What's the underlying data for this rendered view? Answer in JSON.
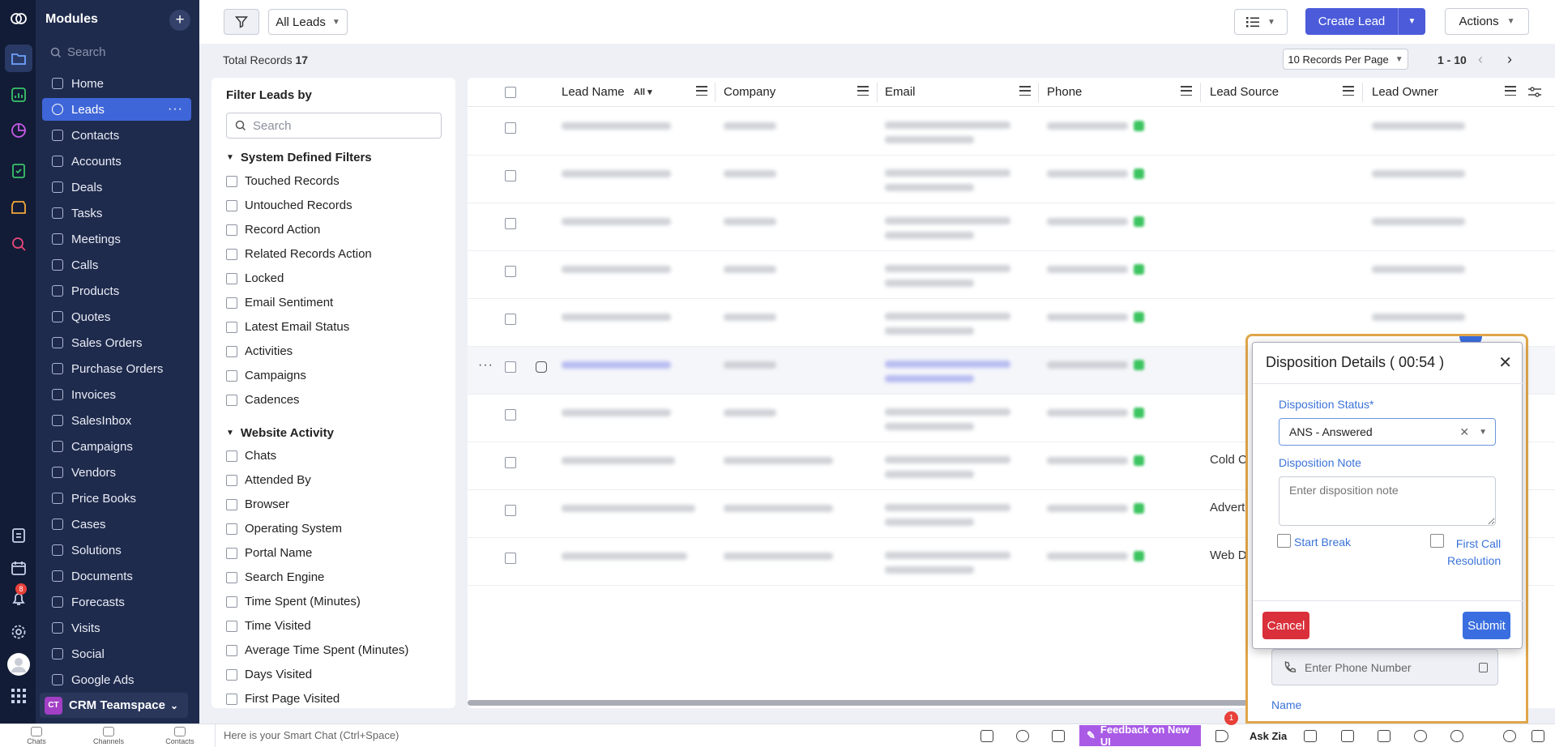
{
  "sidebar": {
    "title": "Modules",
    "search_placeholder": "Search",
    "items": [
      {
        "label": "Home"
      },
      {
        "label": "Leads"
      },
      {
        "label": "Contacts"
      },
      {
        "label": "Accounts"
      },
      {
        "label": "Deals"
      },
      {
        "label": "Tasks"
      },
      {
        "label": "Meetings"
      },
      {
        "label": "Calls"
      },
      {
        "label": "Products"
      },
      {
        "label": "Quotes"
      },
      {
        "label": "Sales Orders"
      },
      {
        "label": "Purchase Orders"
      },
      {
        "label": "Invoices"
      },
      {
        "label": "SalesInbox"
      },
      {
        "label": "Campaigns"
      },
      {
        "label": "Vendors"
      },
      {
        "label": "Price Books"
      },
      {
        "label": "Cases"
      },
      {
        "label": "Solutions"
      },
      {
        "label": "Documents"
      },
      {
        "label": "Forecasts"
      },
      {
        "label": "Visits"
      },
      {
        "label": "Social"
      },
      {
        "label": "Google Ads"
      }
    ],
    "active_item": "Leads",
    "teamspace_badge": "CT",
    "teamspace_label": "CRM Teamspace",
    "notification_count": "8"
  },
  "toolbar": {
    "view_select": "All Leads",
    "create_label": "Create Lead",
    "actions_label": "Actions",
    "accent_color": "#4b5bd9"
  },
  "records": {
    "total_label": "Total Records",
    "total_count": "17",
    "per_page": "10 Records Per Page",
    "range": "1 - 10"
  },
  "filter_panel": {
    "title": "Filter Leads by",
    "search_placeholder": "Search",
    "system_section": "System Defined Filters",
    "system_filters": [
      "Touched Records",
      "Untouched Records",
      "Record Action",
      "Related Records Action",
      "Locked",
      "Email Sentiment",
      "Latest Email Status",
      "Activities",
      "Campaigns",
      "Cadences"
    ],
    "website_section": "Website Activity",
    "website_filters": [
      "Chats",
      "Attended By",
      "Browser",
      "Operating System",
      "Portal Name",
      "Search Engine",
      "Time Spent (Minutes)",
      "Time Visited",
      "Average Time Spent (Minutes)",
      "Days Visited",
      "First Page Visited"
    ]
  },
  "table": {
    "columns": [
      "Lead Name",
      "Company",
      "Email",
      "Phone",
      "Lead Source",
      "Lead Owner"
    ],
    "lead_name_filter": "All",
    "lead_sources": [
      "",
      "",
      "",
      "",
      "",
      "",
      "",
      "Cold C",
      "Advert",
      "Web D"
    ]
  },
  "disposition": {
    "title": "Disposition Details ( 00:54 )",
    "status_label": "Disposition Status*",
    "status_value": "ANS - Answered",
    "note_label": "Disposition Note",
    "note_placeholder": "Enter disposition note",
    "start_break": "Start Break",
    "first_call_line1": "First Call",
    "first_call_line2": "Resolution",
    "cancel": "Cancel",
    "submit": "Submit",
    "phone_placeholder": "Enter Phone Number",
    "name_label": "Name"
  },
  "bottom_bar": {
    "chats": "Chats",
    "channels": "Channels",
    "contacts": "Contacts",
    "smart_chat": "Here is your Smart Chat (Ctrl+Space)",
    "feedback": "Feedback on New UI",
    "ask_zia": "Ask Zia",
    "announce_count": "1"
  }
}
